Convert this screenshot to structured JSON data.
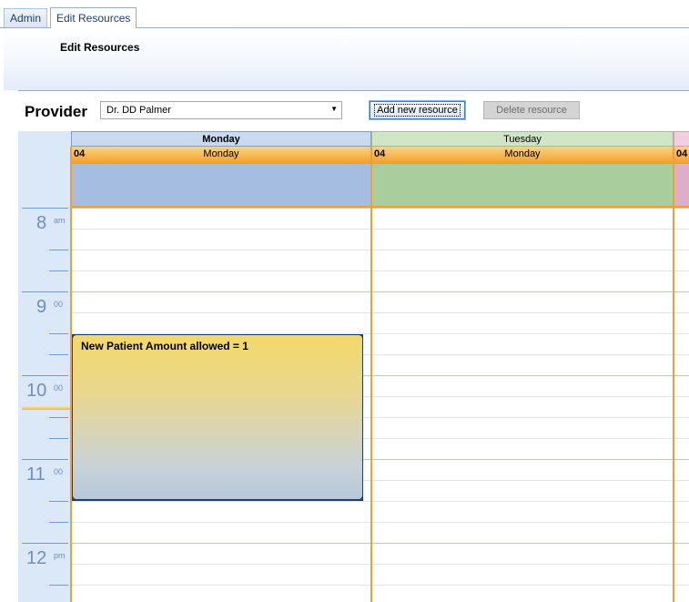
{
  "tabs": [
    {
      "label": "Admin"
    },
    {
      "label": "Edit Resources"
    }
  ],
  "header": {
    "title": "Edit Resources"
  },
  "toolbar": {
    "provider_label": "Provider",
    "provider_selected": "Dr. DD Palmer",
    "add_label": "Add new resource",
    "delete_label": "Delete resource"
  },
  "scheduler": {
    "columns": [
      {
        "header": "Monday",
        "date_num": "04",
        "date_day": "Monday",
        "color": "#a4bde0",
        "header_bg": "#c8d9f0"
      },
      {
        "header": "Tuesday",
        "date_num": "04",
        "date_day": "Monday",
        "color": "#a9cd9c",
        "header_bg": "#cfe5c5"
      },
      {
        "header": "",
        "date_num": "04",
        "date_day": "",
        "color": "#deaec6",
        "header_bg": "#f1cfe0"
      }
    ],
    "hours": [
      {
        "num": "8",
        "suffix": "am"
      },
      {
        "num": "9",
        "suffix": "00"
      },
      {
        "num": "10",
        "suffix": "00"
      },
      {
        "num": "11",
        "suffix": "00"
      },
      {
        "num": "12",
        "suffix": "pm"
      }
    ],
    "appointment": {
      "text": "New Patient Amount allowed = 1"
    }
  },
  "colors": {
    "accent_orange": "#f0a030",
    "appointment_border": "#1e3f6b",
    "timeline_bg": "#dbe8f7"
  },
  "icons": {
    "dropdown": "chevron-down-icon"
  }
}
